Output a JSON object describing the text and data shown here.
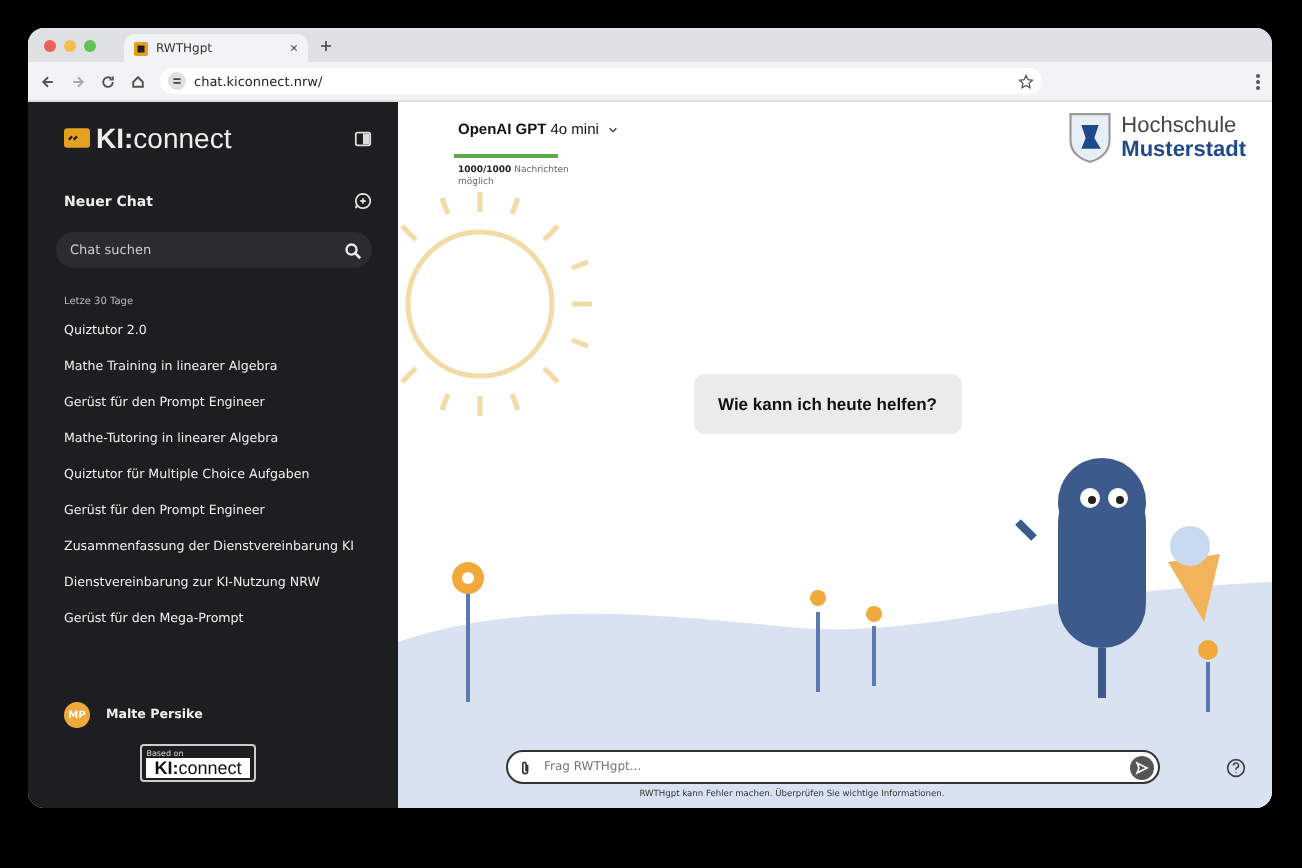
{
  "browser": {
    "tab_title": "RWTHgpt",
    "url": "chat.kiconnect.nrw/"
  },
  "sidebar": {
    "logo": {
      "bold": "KI:",
      "light": "connect"
    },
    "new_chat": "Neuer Chat",
    "search": {
      "placeholder": "Chat suchen"
    },
    "section": "Letze 30 Tage",
    "chats": [
      {
        "title": "Quiztutor 2.0"
      },
      {
        "title": "Mathe Training in linearer Algebra"
      },
      {
        "title": "Gerüst für den Prompt Engineer"
      },
      {
        "title": "Mathe-Tutoring in linearer Algebra"
      },
      {
        "title": "Quiztutor für Multiple Choice Aufgaben"
      },
      {
        "title": "Gerüst für den Prompt Engineer"
      },
      {
        "title": "Zusammenfassung der Dienstvereinbarung KI"
      },
      {
        "title": "Dienstvereinbarung zur KI-Nutzung NRW"
      },
      {
        "title": "Gerüst für den Mega-Prompt"
      }
    ],
    "user": {
      "initials": "MP",
      "name": "Malte Persike"
    },
    "badge": {
      "caption": "Based on",
      "bold": "KI:",
      "light": "connect"
    }
  },
  "main": {
    "model": {
      "vendor": "OpenAI GPT",
      "variant": "4o mini"
    },
    "quota": {
      "level": 1,
      "count": "1000/1000",
      "label": "Nachrichten möglich"
    },
    "school": {
      "line1": "Hochschule",
      "line2": "Musterstadt"
    },
    "greeting": "Wie kann ich heute helfen?",
    "input": {
      "placeholder": "Frag RWTHgpt..."
    },
    "disclaimer": "RWTHgpt kann Fehler machen. Überprüfen Sie wichtige Informationen."
  }
}
